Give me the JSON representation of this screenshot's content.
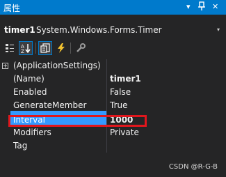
{
  "window": {
    "title": "属性",
    "dropdown_glyph": "▾",
    "pin_glyph": "ᵼ",
    "close_glyph": "✕"
  },
  "object_selector": {
    "name": "timer1",
    "type": "System.Windows.Forms.Timer",
    "dropdown_glyph": "▾"
  },
  "toolbar": {
    "buttons": [
      {
        "icon": "categorized-icon"
      },
      {
        "icon": "alphabetical-icon",
        "active": true
      },
      {
        "icon": "properties-icon",
        "active": true
      },
      {
        "icon": "events-icon"
      },
      {
        "icon": "property-pages-icon"
      }
    ]
  },
  "properties": [
    {
      "name": "(ApplicationSettings)",
      "value": "",
      "expandable": true
    },
    {
      "name": "(Name)",
      "value": "timer1",
      "bold": true
    },
    {
      "name": "Enabled",
      "value": "False"
    },
    {
      "name": "GenerateMember",
      "value": "True"
    },
    {
      "name": "Interval",
      "value": "1000",
      "bold": true,
      "selected": true
    },
    {
      "name": "Modifiers",
      "value": "Private"
    },
    {
      "name": "Tag",
      "value": ""
    }
  ],
  "colors": {
    "accent": "#007acc",
    "selection": "#3399ff",
    "highlight_box": "#e0171d",
    "background": "#252526"
  },
  "watermark": "CSDN @R-G-B"
}
